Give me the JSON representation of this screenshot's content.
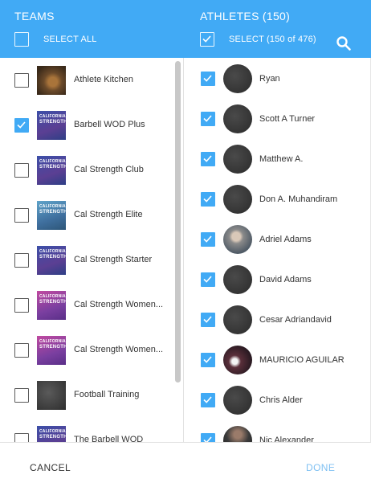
{
  "header": {
    "teams_title": "TEAMS",
    "athletes_title": "ATHLETES (150)",
    "select_all_label": "SELECT ALL",
    "select_athletes_label": "SELECT (150 of 476)"
  },
  "teams": [
    {
      "name": "Athlete Kitchen",
      "checked": false,
      "thumb": "food"
    },
    {
      "name": "Barbell WOD Plus",
      "checked": true,
      "thumb": "logo-blue"
    },
    {
      "name": "Cal Strength Club",
      "checked": false,
      "thumb": "logo-blue"
    },
    {
      "name": "Cal Strength Elite",
      "checked": false,
      "thumb": "logo-teal"
    },
    {
      "name": "Cal Strength Starter",
      "checked": false,
      "thumb": "logo-blue"
    },
    {
      "name": "Cal Strength Women...",
      "checked": false,
      "thumb": "logo-pink"
    },
    {
      "name": "Cal Strength Women...",
      "checked": false,
      "thumb": "logo-pink"
    },
    {
      "name": "Football Training",
      "checked": false,
      "thumb": "gray"
    },
    {
      "name": "The Barbell WOD",
      "checked": false,
      "thumb": "logo-blue"
    }
  ],
  "athletes": [
    {
      "name": "Ryan",
      "checked": true,
      "avatar": "g1"
    },
    {
      "name": "Scott A Turner",
      "checked": true,
      "avatar": "g1"
    },
    {
      "name": "Matthew A.",
      "checked": true,
      "avatar": "g1"
    },
    {
      "name": "Don A. Muhandiram",
      "checked": true,
      "avatar": "g1"
    },
    {
      "name": "Adriel Adams",
      "checked": true,
      "avatar": "photo1"
    },
    {
      "name": "David Adams",
      "checked": true,
      "avatar": "g1"
    },
    {
      "name": "Cesar Adriandavid",
      "checked": true,
      "avatar": "g1"
    },
    {
      "name": "MAURICIO AGUILAR",
      "checked": true,
      "avatar": "photo2"
    },
    {
      "name": "Chris Alder",
      "checked": true,
      "avatar": "g1"
    },
    {
      "name": "Nic Alexander",
      "checked": true,
      "avatar": "photo3"
    }
  ],
  "logo_text": [
    "CALIFORNIA",
    "STRENGTH"
  ],
  "footer": {
    "cancel_label": "CANCEL",
    "done_label": "DONE"
  },
  "colors": {
    "accent": "#41aaf5",
    "done_disabled": "#7fc0f2"
  }
}
